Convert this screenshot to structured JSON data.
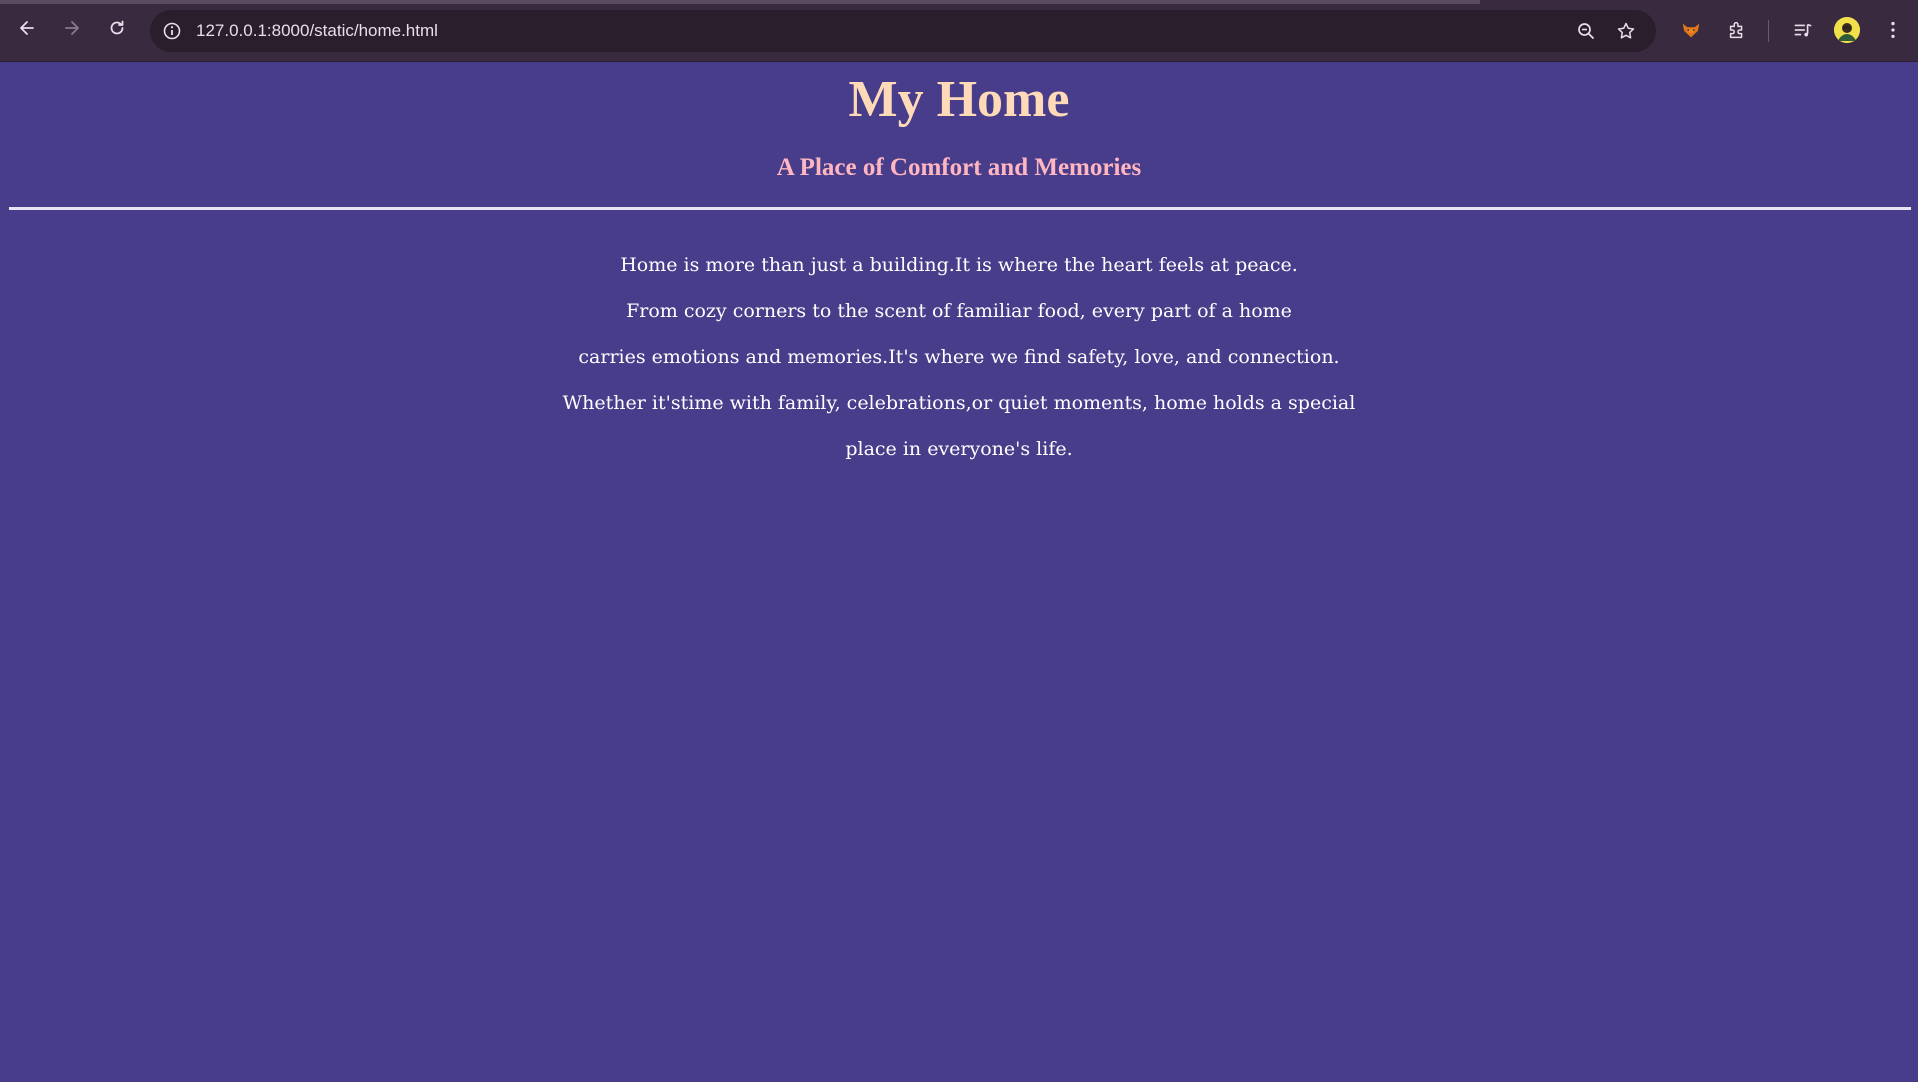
{
  "browser": {
    "url": "127.0.0.1:8000/static/home.html",
    "icons": {
      "back": "arrow-left-icon",
      "forward": "arrow-right-icon",
      "reload": "reload-icon",
      "site_info": "info-icon",
      "zoom": "zoom-out-icon",
      "bookmark": "star-icon",
      "extension_fox": "fox-extension-icon",
      "extensions": "puzzle-icon",
      "media": "media-queue-icon",
      "profile": "avatar",
      "menu": "kebab-menu-icon"
    }
  },
  "page": {
    "title": "My Home",
    "subtitle": "A Place of Comfort and Memories",
    "paragraph_lines": [
      "Home is more than just a building.It is where the heart feels at peace.",
      "From cozy corners to the scent of familiar food, every part of a home",
      "carries emotions and memories.It's where we find safety, love, and connection.",
      "Whether it'stime with family, celebrations,or quiet moments, home holds a special",
      "place in everyone's life."
    ]
  },
  "colors": {
    "background": "#483d8b",
    "title": "#ffdab9",
    "subtitle": "#ffb6c1",
    "text": "#ffffff",
    "browser_bar": "#3a2a3f"
  }
}
